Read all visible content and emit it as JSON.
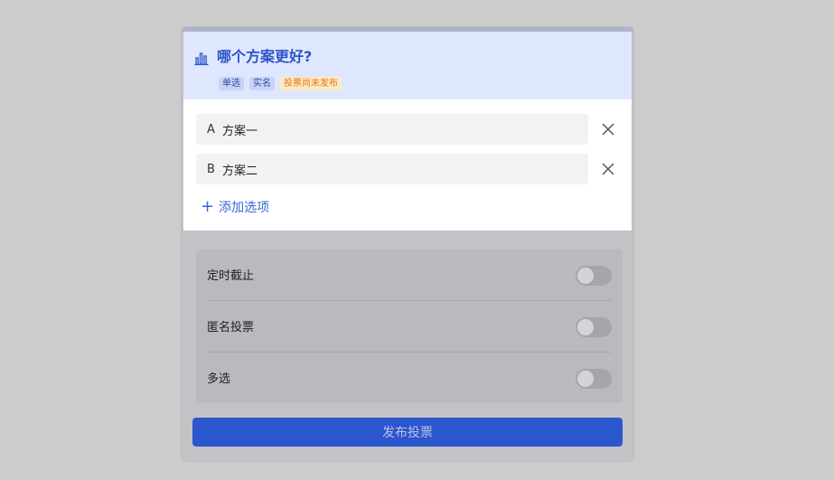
{
  "poll": {
    "icon": "bar-chart-icon",
    "title": "哪个方案更好?",
    "tags": {
      "single": "单选",
      "named": "实名",
      "status": "投票尚未发布"
    }
  },
  "options": [
    {
      "letter": "A",
      "text": "方案一"
    },
    {
      "letter": "B",
      "text": "方案二"
    }
  ],
  "add_option_label": "添加选项",
  "settings": [
    {
      "label": "定时截止",
      "enabled": false
    },
    {
      "label": "匿名投票",
      "enabled": false
    },
    {
      "label": "多选",
      "enabled": false
    }
  ],
  "publish_label": "发布投票",
  "colors": {
    "accent": "#2b56cd",
    "header_bg": "#dfe7ff",
    "status_tag": "#e07a10"
  }
}
